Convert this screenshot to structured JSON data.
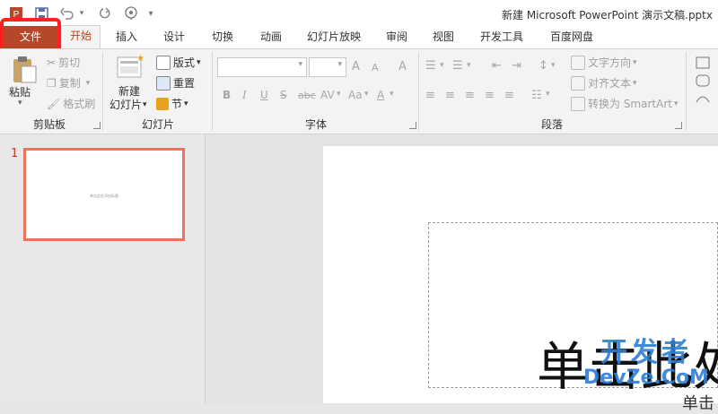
{
  "title_bar": {
    "title": "新建 Microsoft PowerPoint 演示文稿.pptx",
    "quick_access": {
      "save_icon": "save-icon",
      "undo_icon": "undo-icon",
      "redo_icon": "redo-icon",
      "slideshow_icon": "slideshow-icon",
      "customize_icon": "chevron-down-icon"
    }
  },
  "tabs": [
    "文件",
    "开始",
    "插入",
    "设计",
    "切换",
    "动画",
    "幻灯片放映",
    "审阅",
    "视图",
    "开发工具",
    "百度网盘"
  ],
  "ribbon": {
    "clipboard": {
      "paste_label": "粘贴",
      "cut_label": "剪切",
      "copy_label": "复制",
      "format_painter_label": "格式刷",
      "group_label": "剪贴板"
    },
    "slides": {
      "new_slide_line1": "新建",
      "new_slide_line2": "幻灯片",
      "layout_label": "版式",
      "reset_label": "重置",
      "section_label": "节",
      "group_label": "幻灯片"
    },
    "font": {
      "group_label": "字体",
      "grow_label": "A",
      "shrink_label": "A",
      "clear_label": "A",
      "bold_label": "B",
      "italic_label": "I",
      "underline_label": "U",
      "strike_label": "S",
      "shadow_label": "abc",
      "spacing_label": "AV",
      "case_label": "Aa",
      "color_label": "A"
    },
    "paragraph": {
      "group_label": "段落",
      "text_direction_label": "文字方向",
      "align_text_label": "对齐文本",
      "smartart_label": "转换为 SmartArt"
    }
  },
  "thumbnails": {
    "slide_number": "1",
    "thumb_text": "单击此处添加标题"
  },
  "slide": {
    "title_text": "单击此处",
    "subtitle_peek": "单击",
    "watermark_cn": "开发者",
    "watermark_en": "DevZe.CoM"
  },
  "colors": {
    "accent": "#b7472a",
    "highlight": "#ff2020",
    "watermark": "#2e7fd6"
  }
}
